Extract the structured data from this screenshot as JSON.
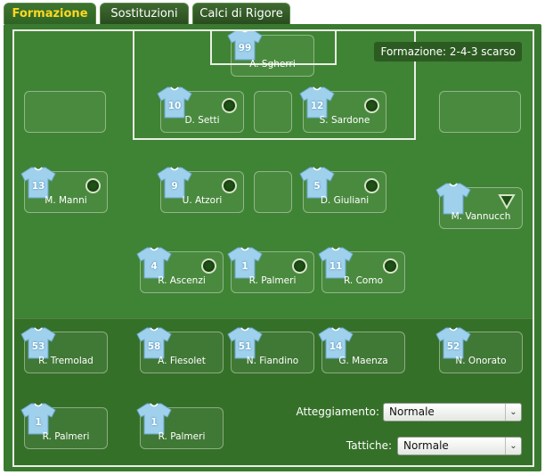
{
  "tabs": [
    {
      "label": "Formazione",
      "active": true
    },
    {
      "label": "Sostituzioni",
      "active": false
    },
    {
      "label": "Calci di Rigore",
      "active": false
    }
  ],
  "formation_label": "Formazione: 2-4-3 scarso",
  "colors": {
    "pitch": "#3f8334",
    "shirt": "#9fd0ec",
    "active_tab_text": "#ffd820"
  },
  "players": {
    "gk": {
      "number": "99",
      "name": "A. Sgherri"
    },
    "d1": {
      "number": "10",
      "name": "D. Setti",
      "indicator": "dot"
    },
    "d2": {
      "number": "12",
      "name": "S. Sardone",
      "indicator": "dot"
    },
    "m1": {
      "number": "13",
      "name": "M. Manni",
      "indicator": "dot"
    },
    "m2": {
      "number": "9",
      "name": "U. Atzori",
      "indicator": "dot"
    },
    "m3": {
      "number": "5",
      "name": "D. Giuliani",
      "indicator": "dot"
    },
    "m4": {
      "number": "",
      "name": "M. Vannucch",
      "indicator": "triangle-down"
    },
    "f1": {
      "number": "4",
      "name": "R. Ascenzi",
      "indicator": "dot"
    },
    "f2": {
      "number": "1",
      "name": "R. Palmeri",
      "indicator": "dot"
    },
    "f3": {
      "number": "11",
      "name": "R. Como",
      "indicator": "dot"
    }
  },
  "bench": [
    {
      "number": "53",
      "name": "R. Tremolad"
    },
    {
      "number": "58",
      "name": "A. Fiesolet"
    },
    {
      "number": "51",
      "name": "N. Fiandino"
    },
    {
      "number": "14",
      "name": "G. Maenza"
    },
    {
      "number": "52",
      "name": "N. Onorato"
    },
    {
      "number": "1",
      "name": "R. Palmeri"
    },
    {
      "number": "1",
      "name": "R. Palmeri"
    }
  ],
  "controls": {
    "attitude": {
      "label": "Atteggiamento:",
      "value": "Normale"
    },
    "tactics": {
      "label": "Tattiche:",
      "value": "Normale"
    }
  }
}
